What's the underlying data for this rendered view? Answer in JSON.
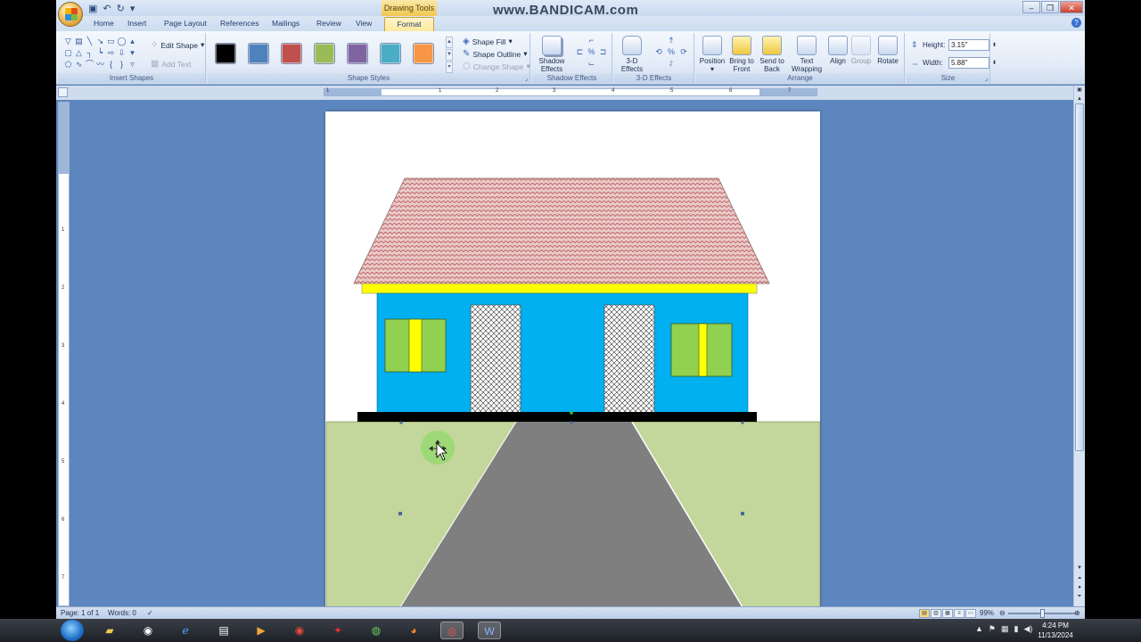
{
  "titlebar": {
    "contextual_tab_group": "Drawing Tools",
    "watermark": "www.BANDICAM.com"
  },
  "tabs": [
    {
      "label": "Home"
    },
    {
      "label": "Insert"
    },
    {
      "label": "Page Layout"
    },
    {
      "label": "References"
    },
    {
      "label": "Mailings"
    },
    {
      "label": "Review"
    },
    {
      "label": "View"
    },
    {
      "label": "Format",
      "active": true
    }
  ],
  "ribbon": {
    "insert_shapes": {
      "label": "Insert Shapes",
      "edit_shape": "Edit Shape",
      "add_text": "Add Text"
    },
    "shape_styles": {
      "label": "Shape Styles",
      "swatch_colors": [
        "#000000",
        "#4f81bd",
        "#c0504d",
        "#9bbb59",
        "#8064a2",
        "#4bacc6",
        "#f79646"
      ],
      "shape_fill": "Shape Fill",
      "shape_outline": "Shape Outline",
      "change_shape": "Change Shape"
    },
    "shadow_effects": {
      "label": "Shadow Effects",
      "button": "Shadow Effects"
    },
    "three_d_effects": {
      "label": "3-D Effects",
      "button": "3-D Effects"
    },
    "arrange": {
      "label": "Arrange",
      "position": "Position",
      "bring_to_front": "Bring to Front",
      "send_to_back": "Send to Back",
      "text_wrapping": "Text Wrapping",
      "align": "Align",
      "group": "Group",
      "rotate": "Rotate"
    },
    "size": {
      "label": "Size",
      "height_label": "Height:",
      "height_value": "3.15\"",
      "width_label": "Width:",
      "width_value": "5.88\""
    }
  },
  "ruler_numbers": [
    "1",
    "1",
    "2",
    "3",
    "4",
    "5",
    "6",
    "7"
  ],
  "vruler_numbers": [
    "1",
    "2",
    "3",
    "4",
    "5",
    "6",
    "7"
  ],
  "drawing_colors": {
    "roof": "#e9c9c9",
    "roof_pattern": "#b3423e",
    "fascia": "#ffff00",
    "wall": "#00b0f0",
    "window_frame": "#92d050",
    "window_bar": "#ffff00",
    "door": "#ffffff",
    "foundation": "#000000",
    "lawn": "#c3d69b",
    "path": "#7f7f7f"
  },
  "statusbar": {
    "page": "Page: 1 of 1",
    "words": "Words: 0",
    "zoom": "99%"
  },
  "taskbar": {
    "time": "4:24 PM",
    "date": "11/13/2024"
  }
}
